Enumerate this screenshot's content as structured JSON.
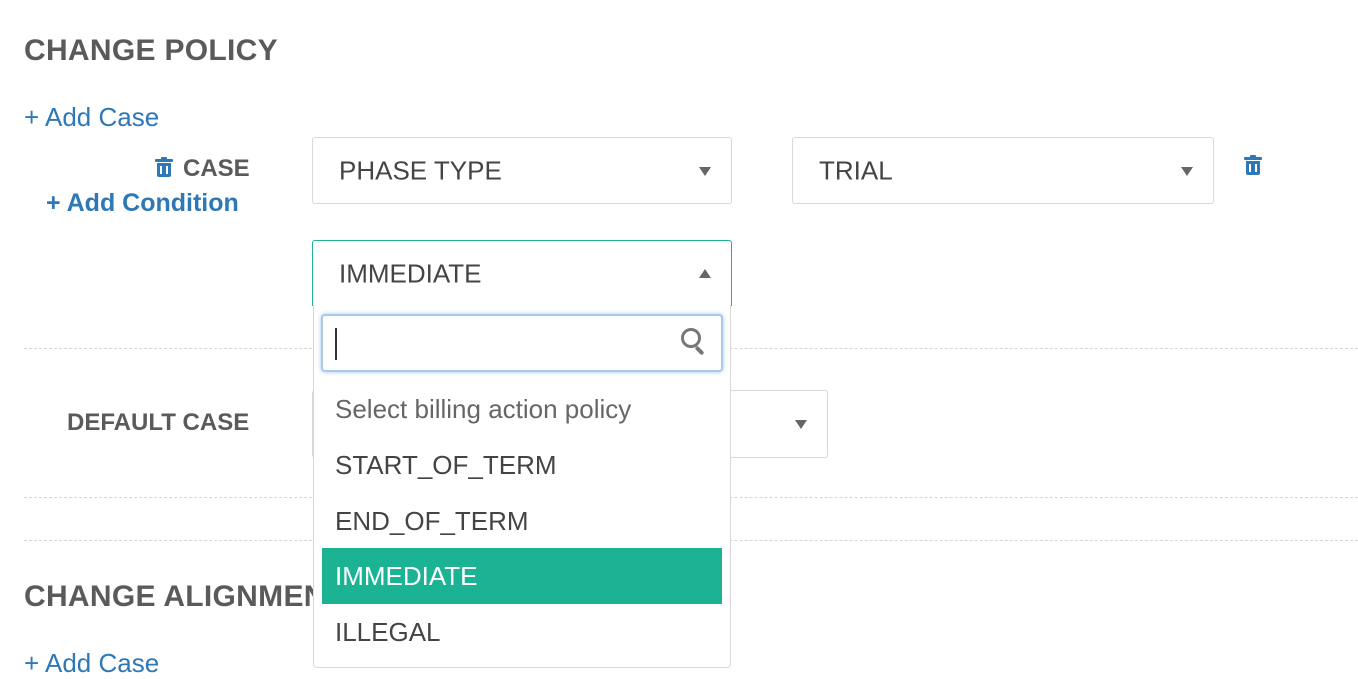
{
  "change_policy": {
    "title": "CHANGE POLICY",
    "add_case_label": "+ Add Case",
    "case": {
      "label": "CASE",
      "add_condition_label": "+ Add Condition",
      "condition_field": "PHASE TYPE",
      "condition_value": "TRIAL",
      "action_policy": "IMMEDIATE"
    },
    "default_case": {
      "label": "DEFAULT CASE"
    }
  },
  "dropdown": {
    "search_value": "",
    "options": [
      "Select billing action policy",
      "START_OF_TERM",
      "END_OF_TERM",
      "IMMEDIATE",
      "ILLEGAL"
    ],
    "selected": "IMMEDIATE"
  },
  "change_alignment": {
    "title": "CHANGE ALIGNMENT",
    "add_case_label": "+ Add Case"
  },
  "colors": {
    "link": "#2f78b7",
    "selected_option": "#1bb394",
    "focus_border": "#1bb394"
  }
}
